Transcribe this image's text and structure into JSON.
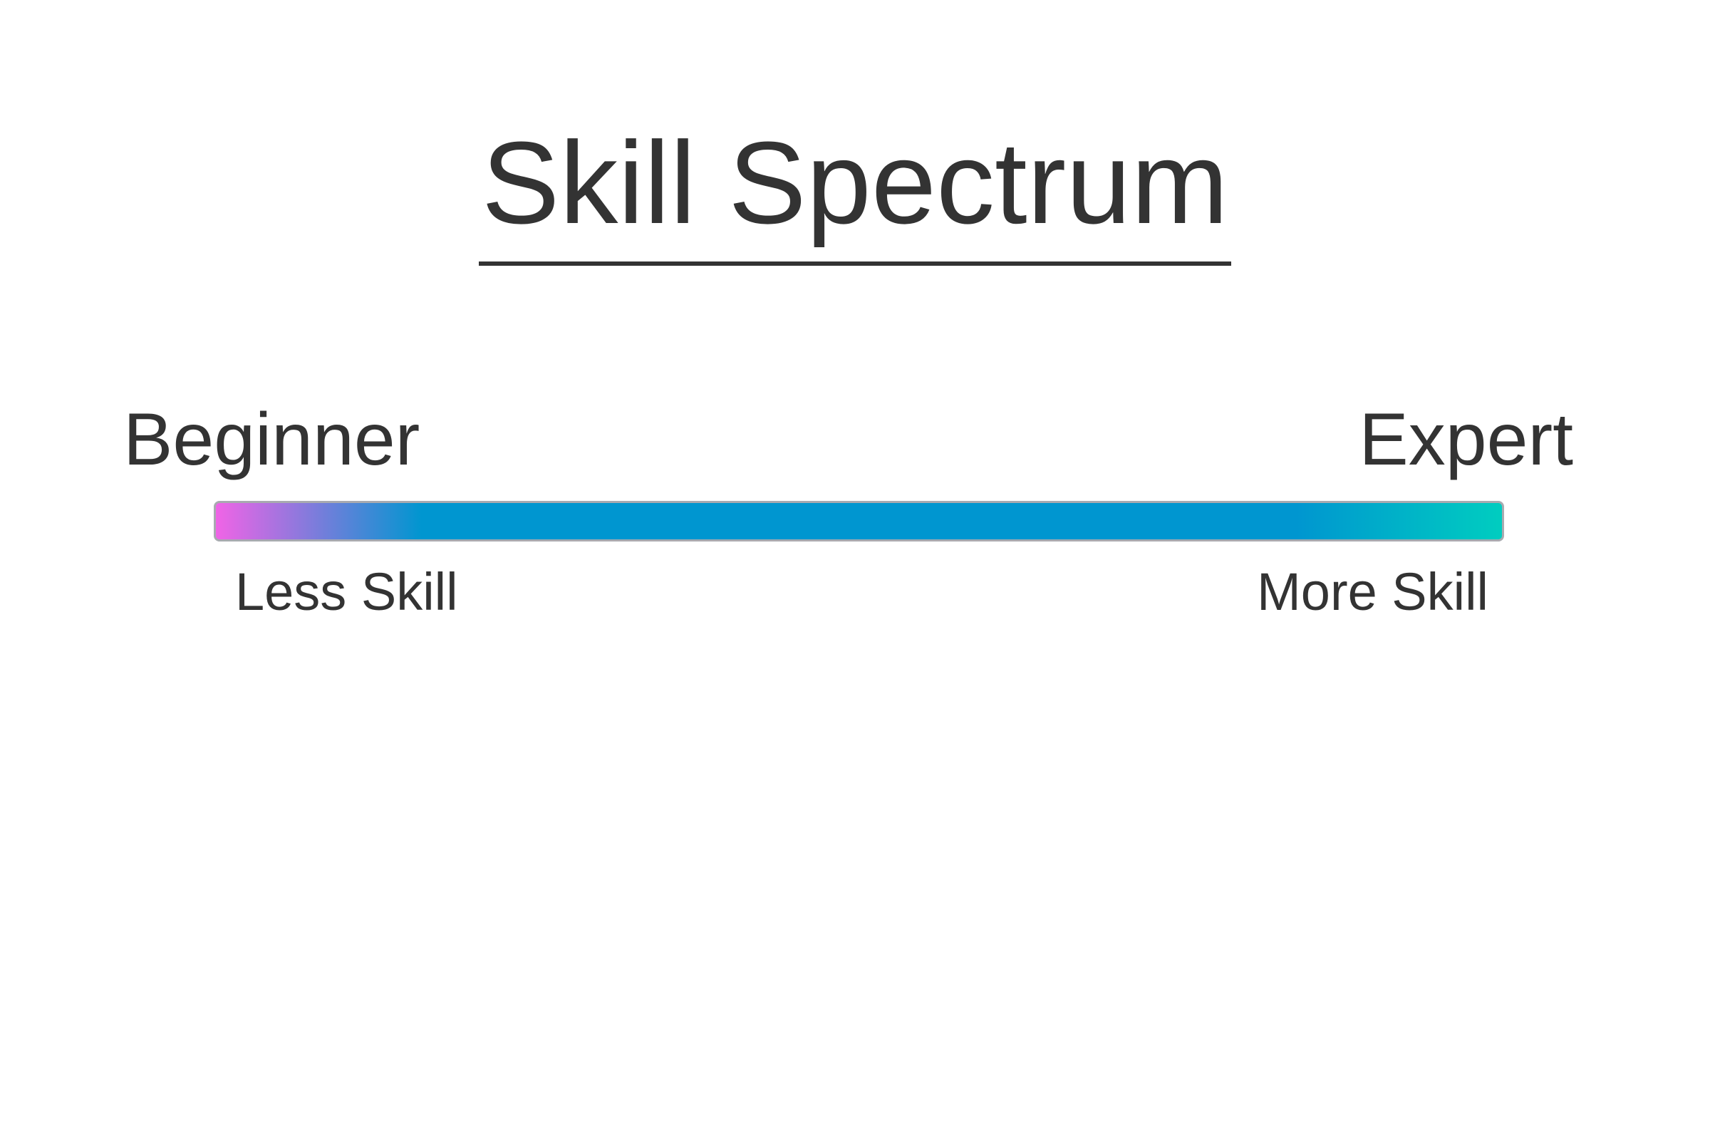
{
  "title": "Skill Spectrum",
  "scale": {
    "left_label": "Beginner",
    "right_label": "Expert",
    "left_caption": "Less Skill",
    "right_caption": "More Skill"
  },
  "colors": {
    "text": "#333333",
    "gradient_start": "#f064e6",
    "gradient_middle": "#0096d0",
    "gradient_end": "#00cdc0",
    "bar_border": "#a8aab0"
  }
}
